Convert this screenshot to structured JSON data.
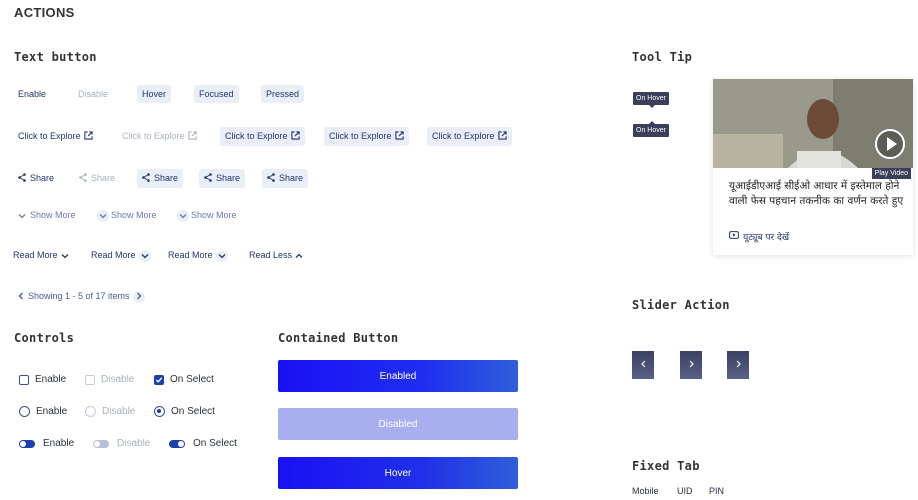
{
  "title": "ACTIONS",
  "sections": {
    "text_button": "Text button",
    "tooltip": "Tool Tip",
    "controls": "Controls",
    "contained": "Contained Button",
    "slider": "Slider Action",
    "fixed_tab": "Fixed Tab"
  },
  "states": {
    "enable": "Enable",
    "disable": "Disable",
    "hover": "Hover",
    "focused": "Focused",
    "pressed": "Pressed"
  },
  "explore_label": "Click to Explore",
  "share_label": "Share",
  "show_more_label": "Show More",
  "read_more_label": "Read More",
  "read_less_label": "Read Less",
  "pagination_text": "Showing 1 - 5 of 17 items",
  "controls": {
    "enable": "Enable",
    "disable": "Disable",
    "on_select": "On Select"
  },
  "contained": {
    "enabled": "Enabled",
    "disabled": "Disabled",
    "hover": "Hover"
  },
  "tooltip_text": "On Hover",
  "video": {
    "title": "यूआईडीएआई सीईओ आधार में इस्तेमाल होने वाली फेस पहचान तकनीक का वर्णन करते हुए",
    "link": "यूट्यूब पर देखें",
    "play_label": "Play Video"
  },
  "fixed_tabs": [
    "Mobile",
    "UID",
    "PIN"
  ]
}
